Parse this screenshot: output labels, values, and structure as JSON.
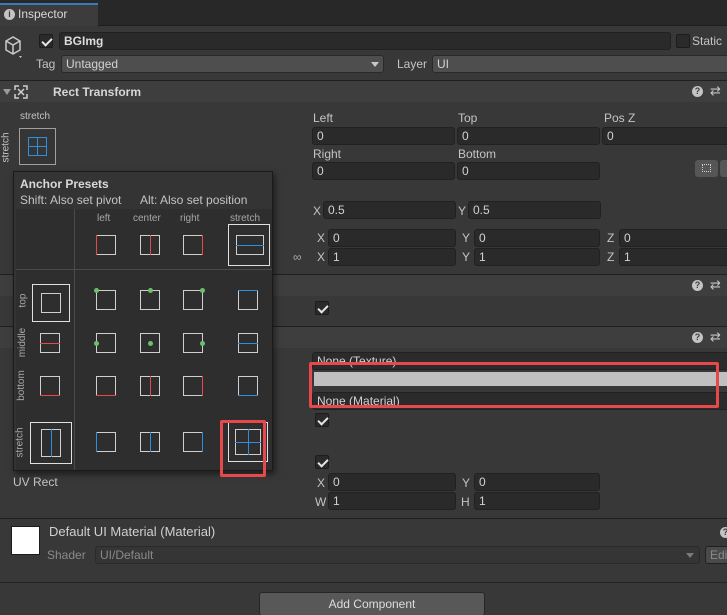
{
  "tab": {
    "title": "Inspector"
  },
  "object": {
    "name": "BGImg",
    "static_label": "Static",
    "tag_label": "Tag",
    "tag_value": "Untagged",
    "layer_label": "Layer",
    "layer_value": "UI"
  },
  "rect": {
    "title": "Rect Transform",
    "anchor_label": "stretch",
    "side_label": "stretch",
    "left_label": "Left",
    "left_value": "0",
    "top_label": "Top",
    "top_value": "0",
    "posz_label": "Pos Z",
    "posz_value": "0",
    "right_label": "Right",
    "right_value": "0",
    "bottom_label": "Bottom",
    "bottom_value": "0",
    "pivot_x": "0.5",
    "pivot_y": "0.5",
    "row1": {
      "x": "0",
      "y": "0",
      "z": "0"
    },
    "row2": {
      "x": "1",
      "y": "1",
      "z": "1"
    }
  },
  "presets": {
    "title": "Anchor Presets",
    "hint_pivot": "Shift: Also set pivot",
    "hint_position": "Alt: Also set position",
    "cols": [
      "left",
      "center",
      "right",
      "stretch"
    ],
    "rows": [
      "top",
      "middle",
      "bottom",
      "stretch"
    ]
  },
  "image": {
    "texture": "None (Texture)",
    "material": "None (Material)",
    "uv_label": "UV Rect",
    "uv": {
      "x": "0",
      "y": "0",
      "w": "1",
      "h": "1"
    }
  },
  "axis": {
    "x": "X",
    "y": "Y",
    "z": "Z",
    "w": "W",
    "h": "H"
  },
  "material": {
    "title": "Default UI Material (Material)",
    "shader_label": "Shader",
    "shader_value": "UI/Default",
    "edit": "Edi"
  },
  "add_component": "Add Component",
  "colors": {
    "highlight": "#e5494b",
    "accent": "#2f8fdc"
  }
}
